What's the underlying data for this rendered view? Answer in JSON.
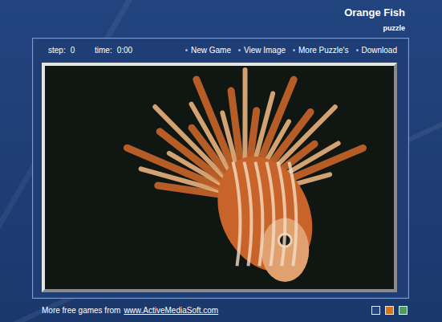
{
  "title": "Orange Fish",
  "subtitle": "puzzle",
  "stats": [
    {
      "label": "step:",
      "value": "0"
    },
    {
      "label": "time:",
      "value": "0:00"
    }
  ],
  "menu": [
    "New Game",
    "View Image",
    "More Puzzle's",
    "Download"
  ],
  "footer": {
    "text": "More free games from",
    "link": "www.ActiveMediaSoft.com"
  },
  "themes": [
    {
      "color": "#24457f"
    },
    {
      "color": "#d8731f"
    },
    {
      "color": "#4f9a5c"
    }
  ]
}
